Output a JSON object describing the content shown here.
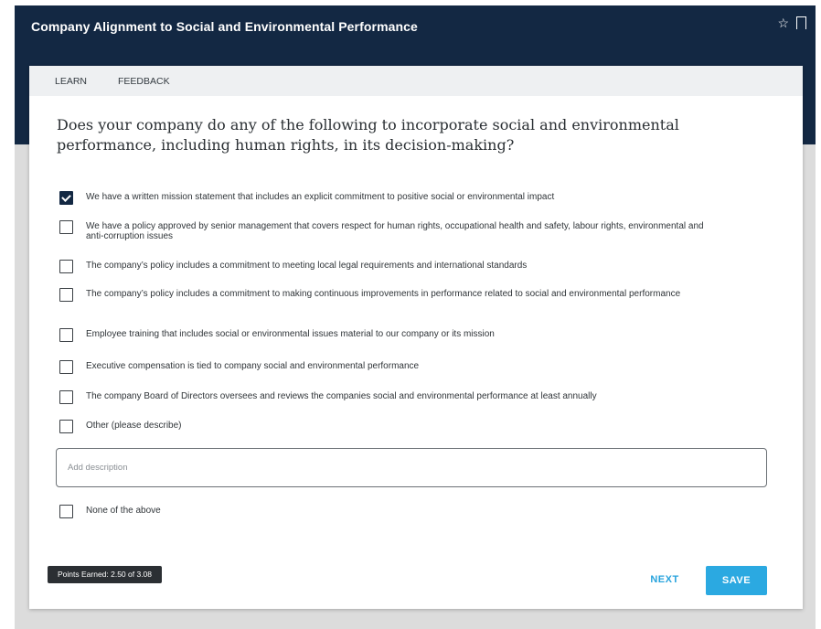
{
  "header": {
    "title": "Company Alignment to Social and Environmental Performance",
    "star_icon": "☆"
  },
  "tabs": [
    {
      "label": "LEARN"
    },
    {
      "label": "FEEDBACK"
    }
  ],
  "question": "Does your company do any of the following to incorporate social and environmental performance, including human rights, in its decision-making?",
  "options": [
    {
      "label": "We have a written mission statement that includes an explicit commitment to positive social or environmental impact",
      "checked": true
    },
    {
      "label": "We have a policy approved by senior management that covers respect for human rights, occupational health and safety, labour rights, environmental and anti-corruption issues",
      "checked": false
    },
    {
      "label": "The company’s policy includes a commitment to meeting local legal requirements and international standards",
      "checked": false
    },
    {
      "label": "The company’s policy includes a commitment to making continuous improvements in performance related to social and environmental performance",
      "checked": false
    },
    {
      "label": "Employee training that includes social or environmental issues material to our company or its mission",
      "checked": false
    },
    {
      "label": "Executive compensation is tied to company social and environmental performance",
      "checked": false
    },
    {
      "label": "The company Board of Directors oversees and reviews the companies social and environmental performance at least annually",
      "checked": false
    },
    {
      "label": "Other (please describe)",
      "checked": false
    },
    {
      "label": "None of the above",
      "checked": false
    }
  ],
  "description": {
    "placeholder": "Add description",
    "value": ""
  },
  "footer": {
    "points": "Points Earned: 2.50 of 3.08",
    "next_label": "NEXT",
    "save_label": "SAVE"
  },
  "colors": {
    "header_bg": "#132843",
    "accent": "#2ba9e1",
    "badge_bg": "#2b2f33"
  }
}
